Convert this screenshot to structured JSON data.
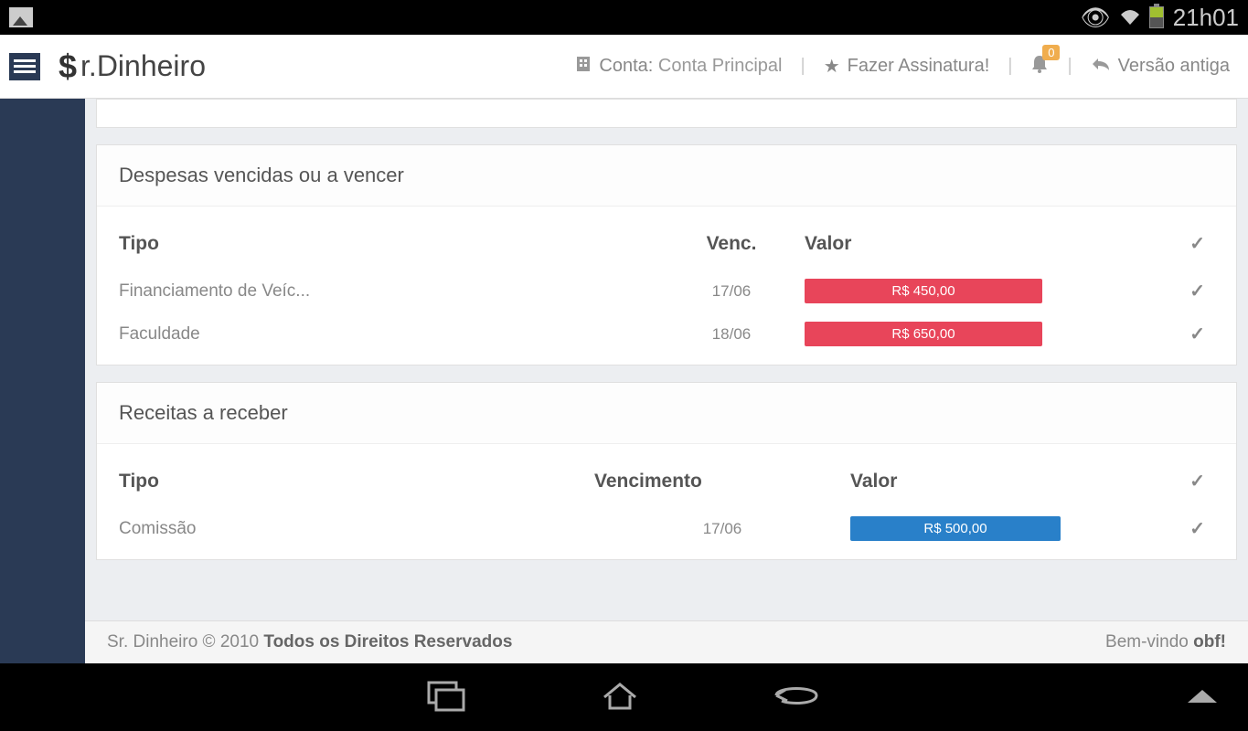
{
  "status": {
    "time": "21h01"
  },
  "header": {
    "logo_text": "r.Dinheiro",
    "logo_prefix": "$",
    "account_label": "Conta:",
    "account_value": "Conta Principal",
    "subscribe": "Fazer Assinatura!",
    "notif_count": "0",
    "old_version": "Versão antiga"
  },
  "panels": {
    "expenses": {
      "title": "Despesas vencidas ou a vencer",
      "headers": {
        "tipo": "Tipo",
        "venc": "Venc.",
        "valor": "Valor"
      },
      "rows": [
        {
          "tipo": "Financiamento de Veíc...",
          "date": "17/06",
          "valor": "R$ 450,00"
        },
        {
          "tipo": "Faculdade",
          "date": "18/06",
          "valor": "R$ 650,00"
        }
      ]
    },
    "incomes": {
      "title": "Receitas a receber",
      "headers": {
        "tipo": "Tipo",
        "venc": "Vencimento",
        "valor": "Valor"
      },
      "rows": [
        {
          "tipo": "Comissão",
          "date": "17/06",
          "valor": "R$ 500,00"
        }
      ]
    }
  },
  "footer": {
    "copyright_prefix": "Sr. Dinheiro © 2010 ",
    "copyright_bold": "Todos os Direitos Reservados",
    "welcome_prefix": "Bem-vindo ",
    "welcome_user": "obf!"
  }
}
